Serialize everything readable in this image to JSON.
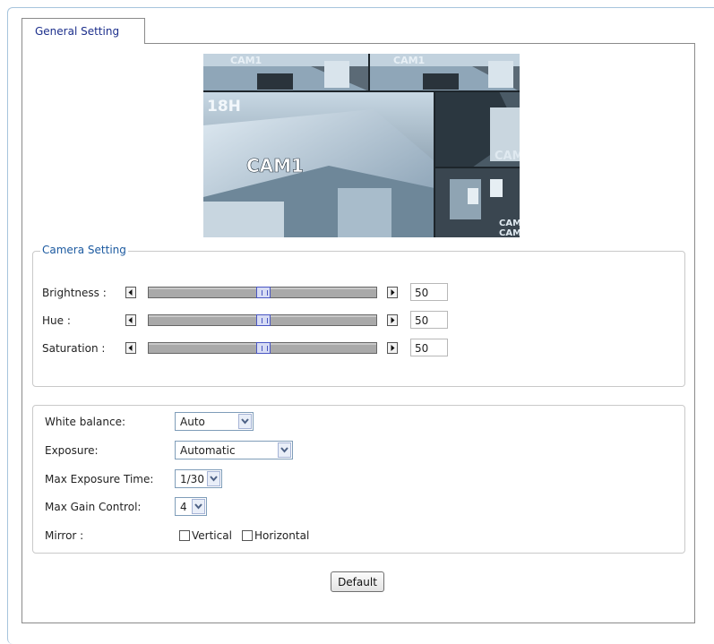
{
  "tab": {
    "label": "General Setting"
  },
  "preview": {
    "cam_label_top_left": "CAM1",
    "cam_label_top_right": "CAM1",
    "overlay_hour": "18H",
    "cam_label_center": "CAM1",
    "cam_label_right": "CAM",
    "cam_label_bottom_right_1": "CAM",
    "cam_label_bottom_right_2": "CAM"
  },
  "camera_setting": {
    "legend": "Camera Setting",
    "sliders": [
      {
        "label": "Brightness :",
        "value": "50",
        "level": 0.5
      },
      {
        "label": "Hue :",
        "value": "50",
        "level": 0.5
      },
      {
        "label": "Saturation :",
        "value": "50",
        "level": 0.5
      }
    ]
  },
  "options": {
    "white_balance": {
      "label": "White balance:",
      "value": "Auto"
    },
    "exposure": {
      "label": "Exposure:",
      "value": "Automatic"
    },
    "max_exposure_time": {
      "label": "Max Exposure Time:",
      "value": "1/30"
    },
    "max_gain_control": {
      "label": "Max Gain Control:",
      "value": "4"
    },
    "mirror": {
      "label": "Mirror :",
      "vertical": "Vertical",
      "horizontal": "Horizontal"
    }
  },
  "default_button": "Default",
  "colors": {
    "tab_text": "#1c2f8c",
    "legend_text": "#1c5aa0",
    "thumb_border": "#4a56c2",
    "frame_border": "#a7c4dd"
  }
}
